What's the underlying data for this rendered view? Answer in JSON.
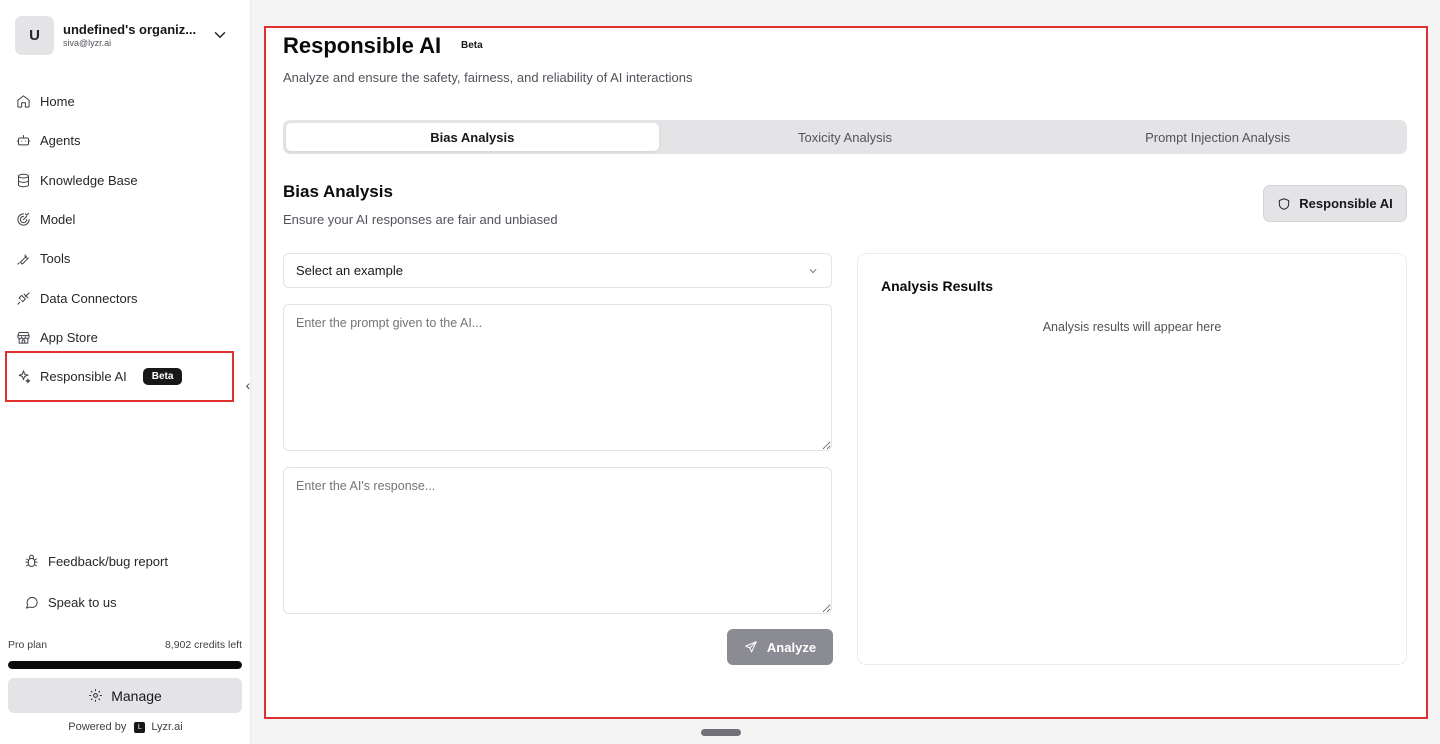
{
  "org": {
    "avatar_letter": "U",
    "name": "undefined's organiz...",
    "email": "siva@lyzr.ai"
  },
  "nav": {
    "items": [
      {
        "label": "Home",
        "icon": "home-icon"
      },
      {
        "label": "Agents",
        "icon": "agents-icon"
      },
      {
        "label": "Knowledge Base",
        "icon": "database-icon"
      },
      {
        "label": "Model",
        "icon": "model-icon"
      },
      {
        "label": "Tools",
        "icon": "wrench-icon"
      },
      {
        "label": "Data Connectors",
        "icon": "plug-icon"
      },
      {
        "label": "App Store",
        "icon": "store-icon"
      },
      {
        "label": "Responsible AI",
        "icon": "sparkle-icon",
        "badge": "Beta",
        "active": true
      }
    ]
  },
  "footer": {
    "feedback_label": "Feedback/bug report",
    "speak_label": "Speak to us",
    "plan_label": "Pro plan",
    "credits_label": "8,902 credits left",
    "credits_fraction": 1.0,
    "manage_label": "Manage",
    "powered_by": "Powered by",
    "brand": "Lyzr.ai"
  },
  "page": {
    "title": "Responsible AI",
    "title_badge": "Beta",
    "subtitle": "Analyze and ensure the safety, fairness, and reliability of AI interactions"
  },
  "tabs": [
    {
      "label": "Bias Analysis",
      "active": true
    },
    {
      "label": "Toxicity Analysis",
      "active": false
    },
    {
      "label": "Prompt Injection Analysis",
      "active": false
    }
  ],
  "section": {
    "title": "Bias Analysis",
    "subtitle": "Ensure your AI responses are fair and unbiased",
    "rai_button": "Responsible AI"
  },
  "form": {
    "select_value": "Select an example",
    "prompt_placeholder": "Enter the prompt given to the AI...",
    "response_placeholder": "Enter the AI's response...",
    "analyze_label": "Analyze"
  },
  "results": {
    "title": "Analysis Results",
    "empty_text": "Analysis results will appear here"
  },
  "colors": {
    "highlight": "#e03131",
    "accent_dark": "#18181b",
    "analyze_disabled": "#8b8b93"
  }
}
